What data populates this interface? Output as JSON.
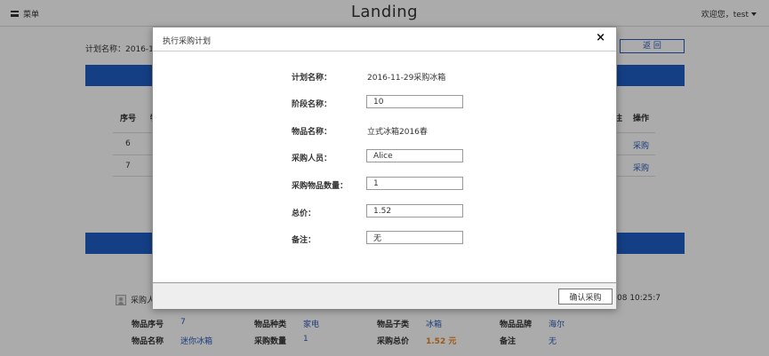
{
  "topbar": {
    "menu_label": "菜单",
    "brand": "Landing",
    "user_greeting": "欢迎您，test"
  },
  "page": {
    "plan_name_label": "计划名称：2016-1",
    "back_label": "返 回"
  },
  "table": {
    "headers": [
      "序号",
      "操作"
    ],
    "partial_headers": [
      "物",
      "注"
    ],
    "rows": [
      {
        "no": "6",
        "action": "采购"
      },
      {
        "no": "7",
        "action": "采购"
      }
    ]
  },
  "record": {
    "buyer_label": "采购人",
    "time": "08 10:25:7",
    "item_no_label": "物品序号",
    "item_no": "7",
    "item_type_label": "物品种类",
    "item_type": "家电",
    "item_subtype_label": "物品子类",
    "item_subtype": "冰箱",
    "brand_label": "物品品牌",
    "brand": "海尔",
    "item_name_label": "物品名称",
    "item_name": "迷你冰箱",
    "qty_label": "采购数量",
    "qty": "1",
    "total_label": "采购总价",
    "total": "1.52 元",
    "remark_label": "备注",
    "remark": "无"
  },
  "modal": {
    "title": "执行采购计划",
    "close_symbol": "×",
    "confirm_label": "确认采购",
    "fields": {
      "plan_name": {
        "label": "计划名称：",
        "value": "2016-11-29采购冰箱"
      },
      "stage_name": {
        "label": "阶段名称：",
        "value": "10"
      },
      "item_name": {
        "label": "物品名称：",
        "value": "立式冰箱2016春"
      },
      "buyer": {
        "label": "采购人员：",
        "value": "Alice"
      },
      "quantity": {
        "label": "采购物品数量：",
        "value": "1"
      },
      "total_price": {
        "label": "总价：",
        "value": "1.52"
      },
      "remark": {
        "label": "备注：",
        "value": "无"
      }
    }
  },
  "colors": {
    "primary_blue": "#1f5fc6",
    "link_blue": "#2a5ab8",
    "price_orange": "#e8821c"
  }
}
